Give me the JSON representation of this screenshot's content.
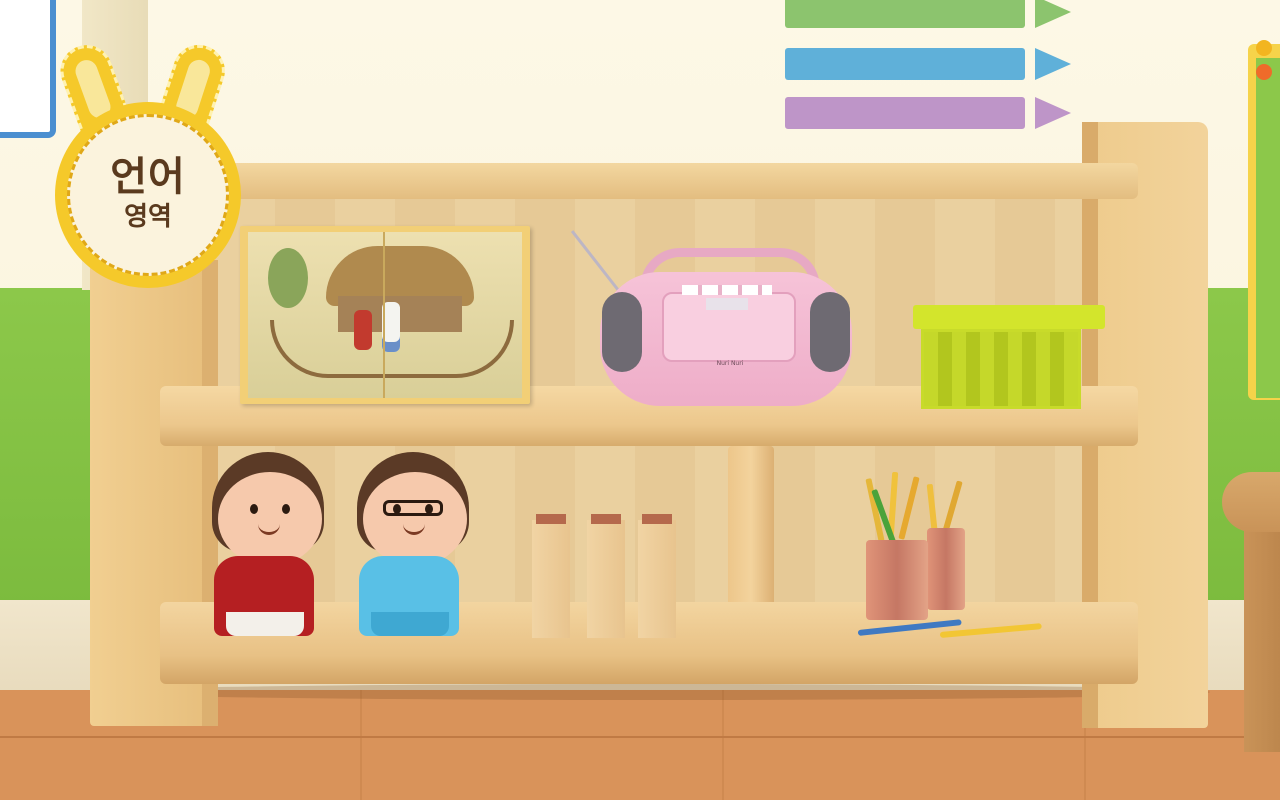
{
  "area_badge": {
    "title": "언어",
    "subtitle": "영역"
  },
  "colors": {
    "badge_yellow": "#f5c92a",
    "wall_green": "#8cc84a",
    "pencil_green": "#8cc46e",
    "pencil_blue": "#5fb0d9",
    "pencil_purple": "#be95c8",
    "radio_pink": "#f2b6cf",
    "basket_lime": "#cfe02a"
  },
  "wall_decoration": {
    "pencil_bars": [
      "green",
      "blue",
      "purple"
    ]
  },
  "shelf": {
    "top_row": [
      "picture-book",
      "cassette-radio",
      "storage-basket"
    ],
    "bottom_row": [
      "girl-doll",
      "boy-doll",
      "wooden-stamps",
      "pencil-cup"
    ]
  },
  "radio": {
    "brand": "Nuri Nuri"
  }
}
